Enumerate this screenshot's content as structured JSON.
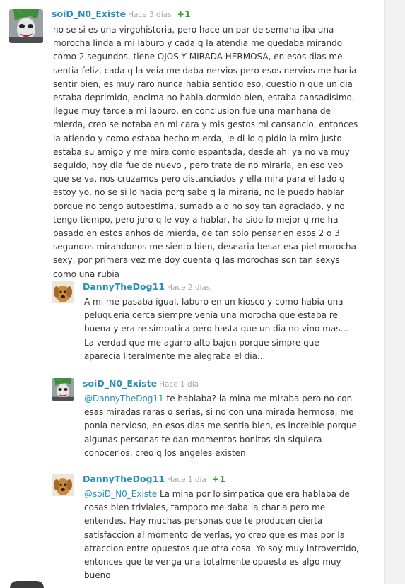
{
  "comments": [
    {
      "author": "soiD_N0_Existe",
      "time": "Hace 3 días",
      "votes": "+1",
      "text": "no se si es una virgohistoria, pero hace un par de semana iba una morocha linda a mi laburo y cada q la atendia me quedaba mirando como 2 segundos, tiene OJOS Y MIRADA HERMOSA, en esos dias me sentia feliz, cada q la veia me daba nervios pero esos nervios me hacia sentir bien, es muy raro nunca habia sentido eso, cuestio n que un dia estaba deprimido, encima no habia dormido bien, estaba cansadisimo, llegue muy tarde a mi laburo, en conclusion fue una manhana de mierda, creo se notaba en mi cara y mis gestos mi cansancio, entonces la atiendo y como estaba hecho mierda, le di lo q pidio la miro justo estaba su amigo y me mira como espantada, desde ahi ya no va muy seguido, hoy dia fue de nuevo , pero trate de no mirarla, en eso veo que se va, nos cruzamos pero distanciados y ella mira para el lado q estoy yo, no se si lo hacia porq sabe q la miraria, no le puedo hablar porque no tengo autoestima, sumado a q no soy tan agraciado, y no tengo tiempo, pero juro q le voy a hablar, ha sido lo mejor q me ha pasado en estos anhos de mierda, de tan solo pensar en esos 2 o 3 segundos mirandonos me siento bien, desearia besar esa piel morocha sexy, por primera vez me doy cuenta q las morochas son tan sexys como una rubia",
      "avatar": "joker-avatar"
    },
    {
      "author": "DannyTheDog11",
      "time": "Hace 2 días",
      "votes": "",
      "text": "A mi me pasaba igual, laburo en un kiosco y como habia una peluqueria cerca siempre venia una morocha que estaba re buena y era re simpatica pero hasta que un dia no vino mas... La verdad que me agarro alto bajon porque simpre que aparecia literalmente me alegraba el dia...",
      "avatar": "dog-avatar"
    },
    {
      "author": "soiD_N0_Existe",
      "time": "Hace 1 día",
      "votes": "",
      "mention": "@DannyTheDog11",
      "text": " te hablaba? la mina me miraba pero no con esas miradas raras o serias, si no con una mirada hermosa, me ponia nervioso, en esos dias me sentia bien, es increible porque algunas personas te dan momentos bonitos sin siquiera conocerlos, creo q los angeles existen",
      "avatar": "joker-avatar"
    },
    {
      "author": "DannyTheDog11",
      "time": "Hace 1 día",
      "votes": "+1",
      "mention": "@soiD_N0_Existe",
      "text": " La mina por lo simpatica que era hablaba de cosas bien triviales, tampoco me daba la charla pero me entendes. Hay muchas personas que te producen cierta satisfaccion al momento de verlas, yo creo que es mas por la atraccion entre opuestos que otra cosa. Yo soy muy introvertido, entonces que te venga una totalmente opuesta es algo muy bueno",
      "avatar": "dog-avatar"
    }
  ],
  "colors": {
    "author": "#2a8fb8",
    "votes": "#2fa12f",
    "time": "#a8a8a8",
    "text": "#333333"
  }
}
